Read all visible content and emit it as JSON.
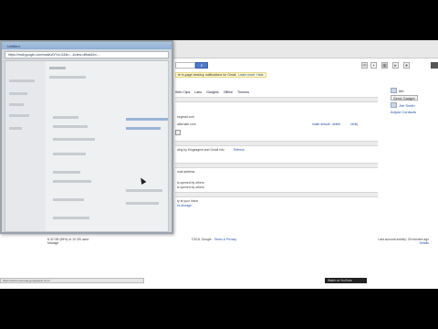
{
  "notification": {
    "text": "te in-page desktop notifications for Gmail.",
    "learn_more": "Learn more",
    "hide": "Hide"
  },
  "tabs": [
    "Web Clips",
    "Labs",
    "Gadgets",
    "Offline",
    "Themes"
  ],
  "profile": {
    "label": "Me",
    "button": "Send Gadget",
    "link1": "Jim Smith",
    "link2": "Adjust Contacts"
  },
  "content_rows": [
    {
      "text": "ezgmail.com",
      "kind": "text"
    },
    {
      "text": "alternate.com",
      "kind": "text"
    },
    {
      "text": "make default",
      "kind": "link"
    },
    {
      "text": "delete",
      "kind": "link"
    },
    {
      "text": "verify",
      "kind": "link"
    },
    {
      "text": "ding by Kingsagent and Gmail info",
      "kind": "text"
    },
    {
      "text": "Refresh",
      "kind": "link"
    },
    {
      "text": "mail address:",
      "kind": "text"
    },
    {
      "text": "is opened by others",
      "kind": "text"
    },
    {
      "text": "is opened by others",
      "kind": "text"
    },
    {
      "text": "ty at your Inbox",
      "kind": "text"
    },
    {
      "text": "es storage",
      "kind": "link"
    }
  ],
  "footer": {
    "left1": "8.32 GB (85%) of 10 GB used",
    "left2": "Manage",
    "mid_text": "©2011 Google -",
    "mid_link": "Terms & Privacy",
    "right1": "Last account activity: 30 minutes ago",
    "right2": "Details"
  },
  "popup": {
    "title": "Untitled",
    "url": "https://mail.google.com/mail/u/0/?ui=2&ik=...&view=dfbat&th=..."
  },
  "status_bar": "https://www.rootsmap.googleapis.com/...",
  "youtube_bar": "Watch on YouTube"
}
